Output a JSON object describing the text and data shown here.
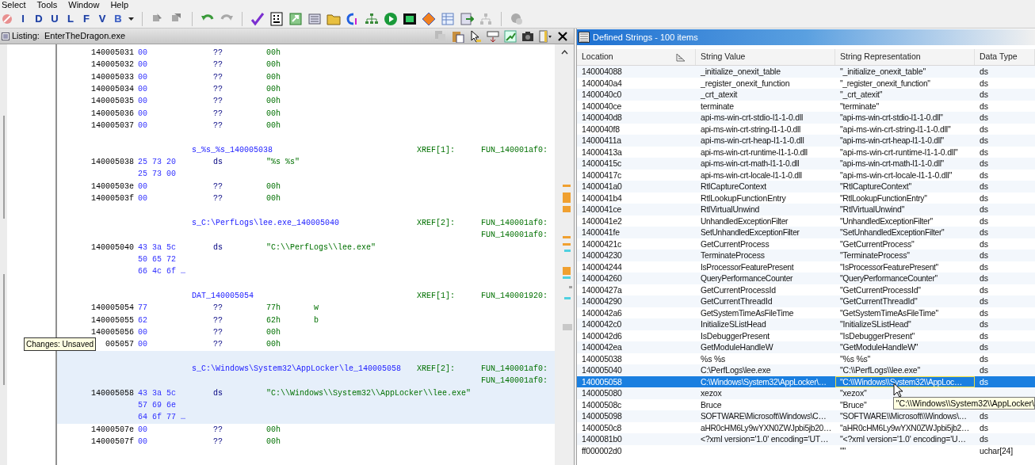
{
  "menu": [
    "Select",
    "Tools",
    "Window",
    "Help"
  ],
  "toolbar": {
    "letter_buttons": [
      "I",
      "D",
      "U",
      "L",
      "F",
      "V",
      "B"
    ]
  },
  "listing": {
    "title": "Listing:  EnterTheDragon.exe",
    "lines": [
      {
        "kind": "data",
        "address": "140005031",
        "bytes": "00",
        "mnemonic": "??",
        "operand": "00h",
        "highlighted": false
      },
      {
        "kind": "data",
        "address": "140005032",
        "bytes": "00",
        "mnemonic": "??",
        "operand": "00h",
        "highlighted": false
      },
      {
        "kind": "data",
        "address": "140005033",
        "bytes": "00",
        "mnemonic": "??",
        "operand": "00h",
        "highlighted": false
      },
      {
        "kind": "data",
        "address": "140005034",
        "bytes": "00",
        "mnemonic": "??",
        "operand": "00h",
        "highlighted": false
      },
      {
        "kind": "data",
        "address": "140005035",
        "bytes": "00",
        "mnemonic": "??",
        "operand": "00h",
        "highlighted": false
      },
      {
        "kind": "data",
        "address": "140005036",
        "bytes": "00",
        "mnemonic": "??",
        "operand": "00h",
        "highlighted": false
      },
      {
        "kind": "data",
        "address": "140005037",
        "bytes": "00",
        "mnemonic": "??",
        "operand": "00h",
        "highlighted": false
      },
      {
        "kind": "blank",
        "highlighted": false
      },
      {
        "kind": "label",
        "label": "s_%s_%s_140005038",
        "xref": "XREF[1]:",
        "target": "FUN_140001af0:",
        "highlighted": false
      },
      {
        "kind": "data",
        "address": "140005038",
        "bytes": "25 73 20",
        "mnemonic": "ds",
        "operand": "\"%s %s\"",
        "highlighted": false
      },
      {
        "kind": "cont",
        "bytes": "25 73 00",
        "highlighted": false
      },
      {
        "kind": "data",
        "address": "14000503e",
        "bytes": "00",
        "mnemonic": "??",
        "operand": "00h",
        "highlighted": false
      },
      {
        "kind": "data",
        "address": "14000503f",
        "bytes": "00",
        "mnemonic": "??",
        "operand": "00h",
        "highlighted": false
      },
      {
        "kind": "blank",
        "highlighted": false
      },
      {
        "kind": "label",
        "label": "s_C:\\PerfLogs\\lee.exe_140005040",
        "xref": "XREF[2]:",
        "target": "FUN_140001af0:",
        "highlighted": false
      },
      {
        "kind": "xref",
        "target": "FUN_140001af0:",
        "highlighted": false
      },
      {
        "kind": "data",
        "address": "140005040",
        "bytes": "43 3a 5c",
        "mnemonic": "ds",
        "operand": "\"C:\\\\PerfLogs\\\\lee.exe\"",
        "highlighted": false
      },
      {
        "kind": "cont",
        "bytes": "50 65 72",
        "highlighted": false
      },
      {
        "kind": "cont",
        "bytes": "66 4c 6f …",
        "highlighted": false
      },
      {
        "kind": "blank",
        "highlighted": false
      },
      {
        "kind": "label",
        "label": "DAT_140005054",
        "xref": "XREF[1]:",
        "target": "FUN_140001920:",
        "highlighted": false
      },
      {
        "kind": "data",
        "address": "140005054",
        "bytes": "77",
        "mnemonic": "??",
        "operand": "77h",
        "comment": "w",
        "highlighted": false
      },
      {
        "kind": "data",
        "address": "140005055",
        "bytes": "62",
        "mnemonic": "??",
        "operand": "62h",
        "comment": "b",
        "highlighted": false
      },
      {
        "kind": "data",
        "address": "140005056",
        "bytes": "00",
        "mnemonic": "??",
        "operand": "00h",
        "highlighted": false
      },
      {
        "kind": "data",
        "address": "005057",
        "bytes": "00",
        "mnemonic": "??",
        "operand": "00h",
        "highlighted": false
      },
      {
        "kind": "blank",
        "highlighted": true
      },
      {
        "kind": "label",
        "label": "s_C:\\Windows\\System32\\AppLocker\\le_140005058",
        "xref": "XREF[2]:",
        "target": "FUN_140001af0:",
        "highlighted": true
      },
      {
        "kind": "xref",
        "target": "FUN_140001af0:",
        "highlighted": true
      },
      {
        "kind": "data",
        "address": "140005058",
        "bytes": "43 3a 5c",
        "mnemonic": "ds",
        "operand": "\"C:\\\\Windows\\\\System32\\\\AppLocker\\\\lee.exe\"",
        "highlighted": true
      },
      {
        "kind": "cont",
        "bytes": "57 69 6e",
        "highlighted": true
      },
      {
        "kind": "cont",
        "bytes": "64 6f 77 …",
        "highlighted": true
      },
      {
        "kind": "data",
        "address": "14000507e",
        "bytes": "00",
        "mnemonic": "??",
        "operand": "00h",
        "highlighted": false
      },
      {
        "kind": "data",
        "address": "14000507f",
        "bytes": "00",
        "mnemonic": "??",
        "operand": "00h",
        "highlighted": false
      }
    ],
    "tooltip": "Changes: Unsaved"
  },
  "strings": {
    "title": "Defined Strings - 100 items",
    "columns": [
      "Location",
      "String Value",
      "String Representation",
      "Data Type"
    ],
    "rows": [
      {
        "location": "140004088",
        "value": "_initialize_onexit_table",
        "representation": "\"_initialize_onexit_table\"",
        "type": "ds",
        "selected": false
      },
      {
        "location": "1400040a4",
        "value": "_register_onexit_function",
        "representation": "\"_register_onexit_function\"",
        "type": "ds",
        "selected": false
      },
      {
        "location": "1400040c0",
        "value": "_crt_atexit",
        "representation": "\"_crt_atexit\"",
        "type": "ds",
        "selected": false
      },
      {
        "location": "1400040ce",
        "value": "terminate",
        "representation": "\"terminate\"",
        "type": "ds",
        "selected": false
      },
      {
        "location": "1400040d8",
        "value": "api-ms-win-crt-stdio-l1-1-0.dll",
        "representation": "\"api-ms-win-crt-stdio-l1-1-0.dll\"",
        "type": "ds",
        "selected": false
      },
      {
        "location": "1400040f8",
        "value": "api-ms-win-crt-string-l1-1-0.dll",
        "representation": "\"api-ms-win-crt-string-l1-1-0.dll\"",
        "type": "ds",
        "selected": false
      },
      {
        "location": "14000411a",
        "value": "api-ms-win-crt-heap-l1-1-0.dll",
        "representation": "\"api-ms-win-crt-heap-l1-1-0.dll\"",
        "type": "ds",
        "selected": false
      },
      {
        "location": "14000413a",
        "value": "api-ms-win-crt-runtime-l1-1-0.dll",
        "representation": "\"api-ms-win-crt-runtime-l1-1-0.dll\"",
        "type": "ds",
        "selected": false
      },
      {
        "location": "14000415c",
        "value": "api-ms-win-crt-math-l1-1-0.dll",
        "representation": "\"api-ms-win-crt-math-l1-1-0.dll\"",
        "type": "ds",
        "selected": false
      },
      {
        "location": "14000417c",
        "value": "api-ms-win-crt-locale-l1-1-0.dll",
        "representation": "\"api-ms-win-crt-locale-l1-1-0.dll\"",
        "type": "ds",
        "selected": false
      },
      {
        "location": "1400041a0",
        "value": "RtlCaptureContext",
        "representation": "\"RtlCaptureContext\"",
        "type": "ds",
        "selected": false
      },
      {
        "location": "1400041b4",
        "value": "RtlLookupFunctionEntry",
        "representation": "\"RtlLookupFunctionEntry\"",
        "type": "ds",
        "selected": false
      },
      {
        "location": "1400041ce",
        "value": "RtlVirtualUnwind",
        "representation": "\"RtlVirtualUnwind\"",
        "type": "ds",
        "selected": false
      },
      {
        "location": "1400041e2",
        "value": "UnhandledExceptionFilter",
        "representation": "\"UnhandledExceptionFilter\"",
        "type": "ds",
        "selected": false
      },
      {
        "location": "1400041fe",
        "value": "SetUnhandledExceptionFilter",
        "representation": "\"SetUnhandledExceptionFilter\"",
        "type": "ds",
        "selected": false
      },
      {
        "location": "14000421c",
        "value": "GetCurrentProcess",
        "representation": "\"GetCurrentProcess\"",
        "type": "ds",
        "selected": false
      },
      {
        "location": "140004230",
        "value": "TerminateProcess",
        "representation": "\"TerminateProcess\"",
        "type": "ds",
        "selected": false
      },
      {
        "location": "140004244",
        "value": "IsProcessorFeaturePresent",
        "representation": "\"IsProcessorFeaturePresent\"",
        "type": "ds",
        "selected": false
      },
      {
        "location": "140004260",
        "value": "QueryPerformanceCounter",
        "representation": "\"QueryPerformanceCounter\"",
        "type": "ds",
        "selected": false
      },
      {
        "location": "14000427a",
        "value": "GetCurrentProcessId",
        "representation": "\"GetCurrentProcessId\"",
        "type": "ds",
        "selected": false
      },
      {
        "location": "140004290",
        "value": "GetCurrentThreadId",
        "representation": "\"GetCurrentThreadId\"",
        "type": "ds",
        "selected": false
      },
      {
        "location": "1400042a6",
        "value": "GetSystemTimeAsFileTime",
        "representation": "\"GetSystemTimeAsFileTime\"",
        "type": "ds",
        "selected": false
      },
      {
        "location": "1400042c0",
        "value": "InitializeSListHead",
        "representation": "\"InitializeSListHead\"",
        "type": "ds",
        "selected": false
      },
      {
        "location": "1400042d6",
        "value": "IsDebuggerPresent",
        "representation": "\"IsDebuggerPresent\"",
        "type": "ds",
        "selected": false
      },
      {
        "location": "1400042ea",
        "value": "GetModuleHandleW",
        "representation": "\"GetModuleHandleW\"",
        "type": "ds",
        "selected": false
      },
      {
        "location": "140005038",
        "value": "%s %s",
        "representation": "\"%s %s\"",
        "type": "ds",
        "selected": false
      },
      {
        "location": "140005040",
        "value": "C:\\PerfLogs\\lee.exe",
        "representation": "\"C:\\\\PerfLogs\\\\lee.exe\"",
        "type": "ds",
        "selected": false
      },
      {
        "location": "140005058",
        "value": "C:\\Windows\\System32\\AppLocker\\…",
        "representation": "\"C:\\\\Windows\\\\System32\\\\AppLoc…",
        "type": "ds",
        "selected": true
      },
      {
        "location": "140005080",
        "value": "xezox",
        "representation": "\"xezox\"",
        "selected": false
      },
      {
        "location": "14000508c",
        "value": "Bruce",
        "representation": "\"Bruce\"",
        "selected": false
      },
      {
        "location": "140005098",
        "value": "SOFTWARE\\Microsoft\\Windows\\C…",
        "representation": "\"SOFTWARE\\\\Microsoft\\\\Windows\\…",
        "type": "ds",
        "selected": false
      },
      {
        "location": "1400050c8",
        "value": "aHR0cHM6Ly9wYXN0ZWJpbi5jb20…",
        "representation": "\"aHR0cHM6Ly9wYXN0ZWJpbi5jb2…",
        "type": "ds",
        "selected": false
      },
      {
        "location": "1400081b0",
        "value": "<?xml version='1.0' encoding='UT…",
        "representation": "\"<?xml version='1.0' encoding='U…",
        "type": "ds",
        "selected": false
      },
      {
        "location": "ff000002d0",
        "representation": "\"\"",
        "type": "uchar[24]",
        "selected": false
      }
    ],
    "tooltip": "\"C:\\\\Windows\\\\System32\\\\AppLocker\\"
  }
}
